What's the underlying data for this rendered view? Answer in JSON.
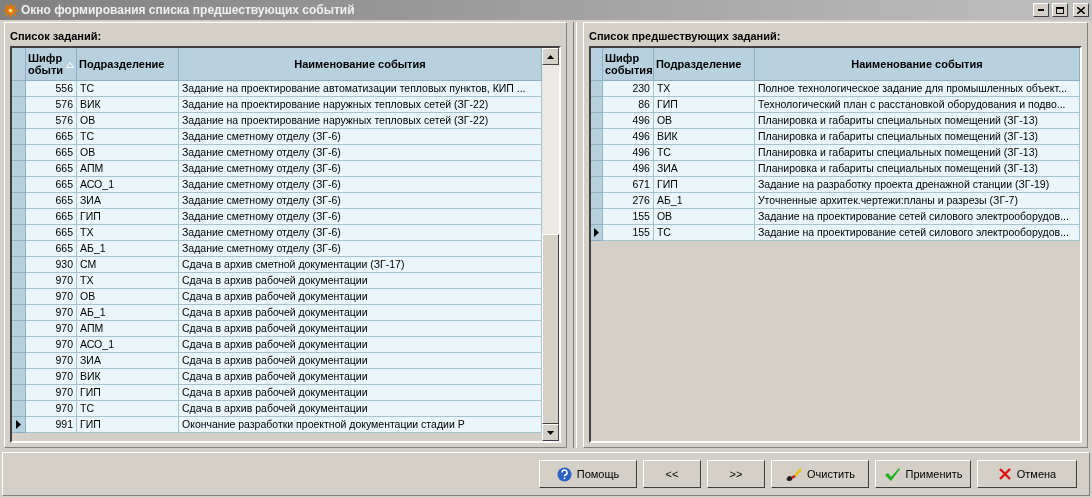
{
  "window": {
    "title": "Окно формирования списка предшествующих событий"
  },
  "left_panel": {
    "label": "Список заданий:",
    "columns": [
      {
        "label": "Шифр обыти",
        "sorted": true
      },
      {
        "label": "Подразделение",
        "sorted": false
      },
      {
        "label": "Наименование события",
        "sorted": false
      }
    ],
    "rows": [
      {
        "code": "556",
        "department": "ТС",
        "event": "Задание на проектирование автоматизации тепловых пунктов, КИП ...",
        "current": false
      },
      {
        "code": "576",
        "department": "ВИК",
        "event": "Задание на проектирование наружных тепловых сетей (ЗГ-22)",
        "current": false
      },
      {
        "code": "576",
        "department": "ОВ",
        "event": "Задание на проектирование наружных тепловых сетей (ЗГ-22)",
        "current": false
      },
      {
        "code": "665",
        "department": "ТС",
        "event": "Задание сметному отделу  (ЗГ-6)",
        "current": false
      },
      {
        "code": "665",
        "department": "ОВ",
        "event": "Задание сметному отделу  (ЗГ-6)",
        "current": false
      },
      {
        "code": "665",
        "department": "АПМ",
        "event": "Задание сметному отделу  (ЗГ-6)",
        "current": false
      },
      {
        "code": "665",
        "department": "АСО_1",
        "event": "Задание сметному отделу  (ЗГ-6)",
        "current": false
      },
      {
        "code": "665",
        "department": "ЗИА",
        "event": "Задание сметному отделу  (ЗГ-6)",
        "current": false
      },
      {
        "code": "665",
        "department": "ГИП",
        "event": "Задание сметному отделу  (ЗГ-6)",
        "current": false
      },
      {
        "code": "665",
        "department": "ТХ",
        "event": "Задание сметному отделу  (ЗГ-6)",
        "current": false
      },
      {
        "code": "665",
        "department": "АБ_1",
        "event": "Задание сметному отделу  (ЗГ-6)",
        "current": false
      },
      {
        "code": "930",
        "department": "СМ",
        "event": "Сдача в архив сметной документации (ЗГ-17)",
        "current": false
      },
      {
        "code": "970",
        "department": "ТХ",
        "event": "Сдача в архив рабочей документации",
        "current": false
      },
      {
        "code": "970",
        "department": "ОВ",
        "event": "Сдача в архив рабочей документации",
        "current": false
      },
      {
        "code": "970",
        "department": "АБ_1",
        "event": "Сдача в архив рабочей документации",
        "current": false
      },
      {
        "code": "970",
        "department": "АПМ",
        "event": "Сдача в архив рабочей документации",
        "current": false
      },
      {
        "code": "970",
        "department": "АСО_1",
        "event": "Сдача в архив рабочей документации",
        "current": false
      },
      {
        "code": "970",
        "department": "ЗИА",
        "event": "Сдача в архив рабочей документации",
        "current": false
      },
      {
        "code": "970",
        "department": "ВИК",
        "event": "Сдача в архив рабочей документации",
        "current": false
      },
      {
        "code": "970",
        "department": "ГИП",
        "event": "Сдача в архив рабочей документации",
        "current": false
      },
      {
        "code": "970",
        "department": "ТС",
        "event": "Сдача в архив рабочей документации",
        "current": false
      },
      {
        "code": "991",
        "department": "ГИП",
        "event": "Окончание разработки проектной документации стадии Р",
        "current": true
      }
    ]
  },
  "right_panel": {
    "label": "Список предшествующих заданий:",
    "columns": [
      {
        "label": "Шифр события",
        "sorted": false
      },
      {
        "label": "Подразделение",
        "sorted": false
      },
      {
        "label": "Наименование события",
        "sorted": false
      }
    ],
    "rows": [
      {
        "code": "230",
        "department": "ТХ",
        "event": "Полное технологическое задание для промышленных объект...",
        "current": false
      },
      {
        "code": "86",
        "department": "ГИП",
        "event": "Технологический план с расстановкой оборудования и подво...",
        "current": false
      },
      {
        "code": "496",
        "department": "ОВ",
        "event": "Планировка и габариты специальных помещений (ЗГ-13)",
        "current": false
      },
      {
        "code": "496",
        "department": "ВИК",
        "event": "Планировка и габариты специальных помещений (ЗГ-13)",
        "current": false
      },
      {
        "code": "496",
        "department": "ТС",
        "event": "Планировка и габариты специальных помещений (ЗГ-13)",
        "current": false
      },
      {
        "code": "496",
        "department": "ЗИА",
        "event": "Планировка и габариты специальных помещений (ЗГ-13)",
        "current": false
      },
      {
        "code": "671",
        "department": "ГИП",
        "event": "Задание на разработку проекта дренажной станции (ЗГ-19)",
        "current": false
      },
      {
        "code": "276",
        "department": "АБ_1",
        "event": "Уточненные архитек.чертежи:планы и разрезы (ЗГ-7)",
        "current": false
      },
      {
        "code": "155",
        "department": "ОВ",
        "event": "Задание на проектирование сетей силового электрооборудов...",
        "current": false
      },
      {
        "code": "155",
        "department": "ТС",
        "event": "Задание на проектирование сетей силового электрооборудов...",
        "current": true
      }
    ]
  },
  "buttons": [
    {
      "kind": "help",
      "label": "Помощь"
    },
    {
      "kind": "prev",
      "label": "<<"
    },
    {
      "kind": "next",
      "label": ">>"
    },
    {
      "kind": "clear",
      "label": "Очистить"
    },
    {
      "kind": "apply",
      "label": "Применить"
    },
    {
      "kind": "cancel",
      "label": "Отмена"
    }
  ]
}
